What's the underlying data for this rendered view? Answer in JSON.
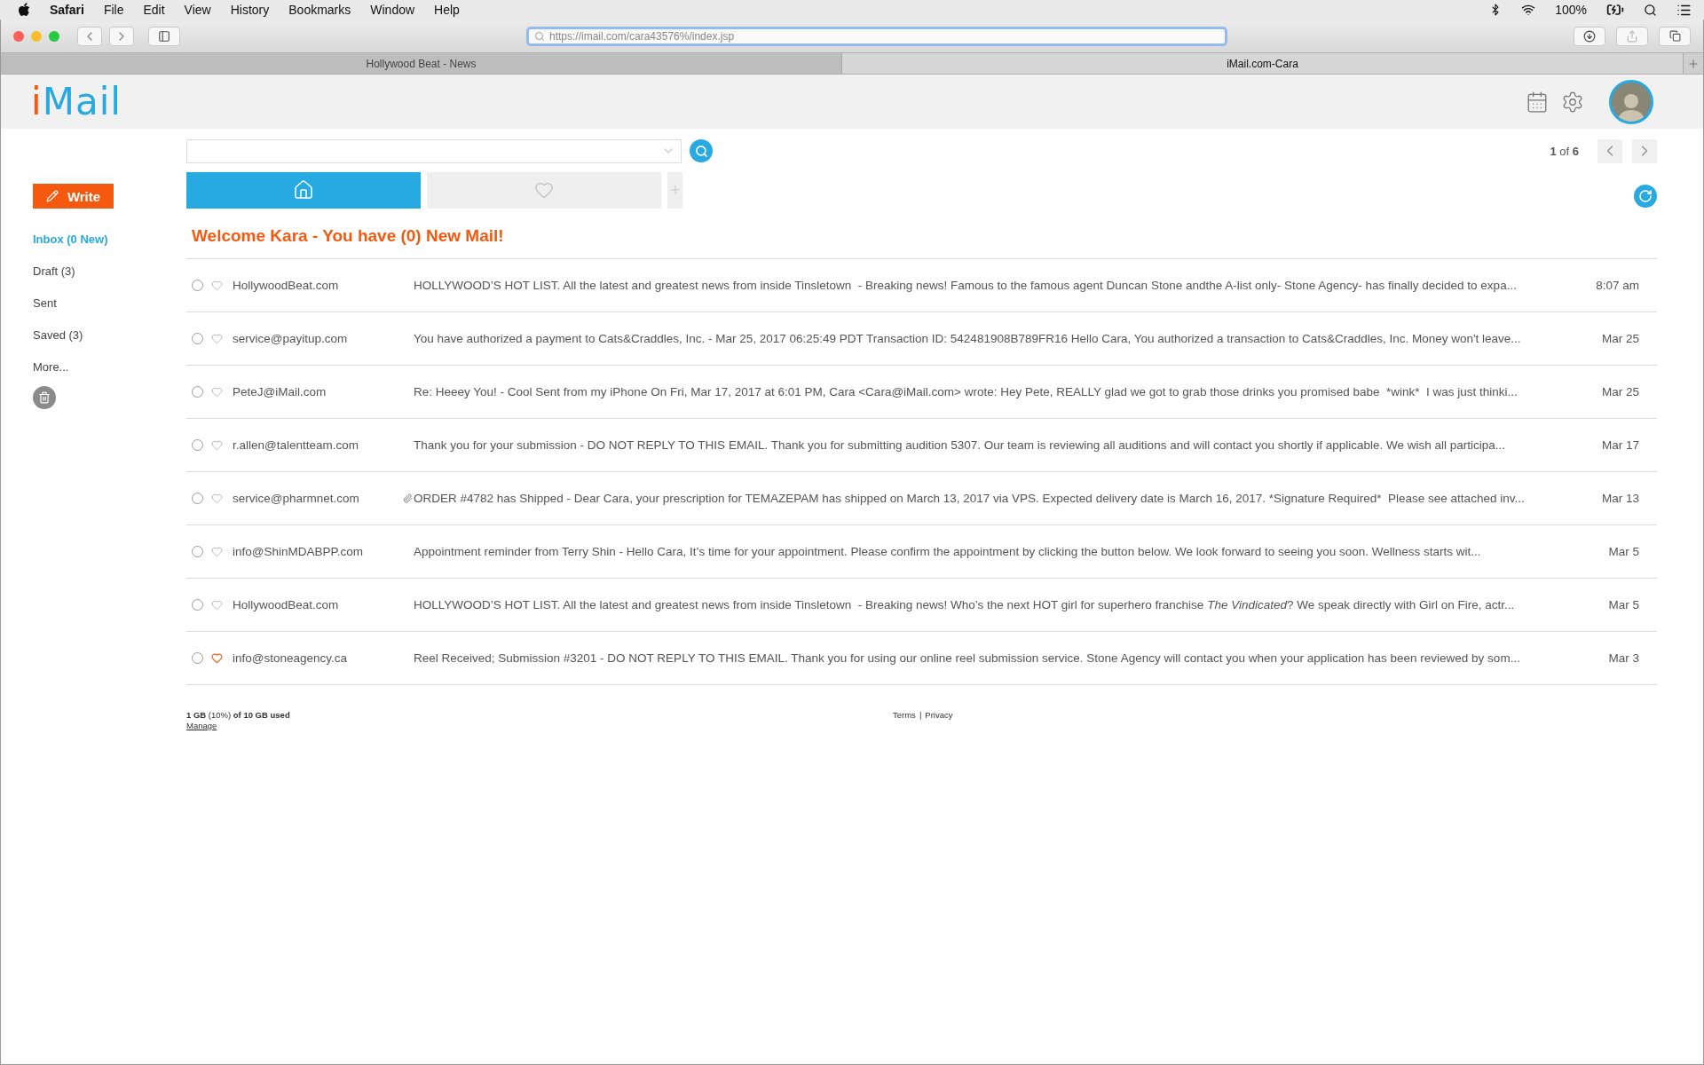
{
  "menu_bar": {
    "app": "Safari",
    "items": [
      "File",
      "Edit",
      "View",
      "History",
      "Bookmarks",
      "Window",
      "Help"
    ],
    "battery": "100%"
  },
  "browser": {
    "address": "https://imail.com/cara43576%/index.jsp",
    "tabs": [
      {
        "title": "Hollywood Beat - News",
        "selected": false
      },
      {
        "title": "iMail.com-Cara",
        "selected": true
      }
    ]
  },
  "header": {
    "logo_first": "i",
    "logo_rest": "Mail"
  },
  "sidebar": {
    "write_button": "Write",
    "items": [
      {
        "label": "Inbox (0 New)",
        "selected": true
      },
      {
        "label": "Draft (3)",
        "selected": false
      },
      {
        "label": "Sent",
        "selected": false
      },
      {
        "label": "Saved (3)",
        "selected": false
      },
      {
        "label": "More...",
        "selected": false
      }
    ]
  },
  "pager": {
    "current": "1",
    "separator": "of",
    "total": "6"
  },
  "mail_tabs": [
    {
      "kind": "home",
      "selected": true
    },
    {
      "kind": "favorites",
      "selected": false
    }
  ],
  "welcome": "Welcome Kara - You have (0) New Mail!",
  "messages": [
    {
      "checked": false,
      "favorite": false,
      "attachment": false,
      "sender": "HollywoodBeat.com",
      "snippet": [
        {
          "text": "HOLLYWOOD’S HOT LIST. All the latest and greatest news from inside Tinsletown  - Breaking news! Famous to the famous agent Duncan Stone andthe A-list only- Stone Agency- has finally decided to expa...",
          "italic": false
        }
      ],
      "date": "8:07 am"
    },
    {
      "checked": false,
      "favorite": false,
      "attachment": false,
      "sender": "service@payitup.com",
      "snippet": [
        {
          "text": "You have authorized a payment to Cats&Craddles, Inc. - Mar 25, 2017 06:25:49 PDT Transaction ID: 542481908B789FR16 Hello Cara, You authorized a transaction to Cats&Craddles, Inc. Money won't leave...",
          "italic": false
        }
      ],
      "date": "Mar 25"
    },
    {
      "checked": false,
      "favorite": false,
      "attachment": false,
      "sender": "PeteJ@iMail.com",
      "snippet": [
        {
          "text": "Re: Heeey You! - Cool Sent from my iPhone On Fri, Mar 17, 2017 at 6:01 PM, Cara <Cara@iMail.com> wrote: Hey Pete, REALLY glad we got to grab those drinks you promised babe  *wink*  I was just thinki...",
          "italic": false
        }
      ],
      "date": "Mar 25"
    },
    {
      "checked": false,
      "favorite": false,
      "attachment": false,
      "sender": "r.allen@talentteam.com",
      "snippet": [
        {
          "text": "Thank you for your submission - DO NOT REPLY TO THIS EMAIL. Thank you for submitting audition 5307. Our team is reviewing all auditions and will contact you shortly if applicable. We wish all participa...",
          "italic": false
        }
      ],
      "date": "Mar 17"
    },
    {
      "checked": false,
      "favorite": false,
      "attachment": true,
      "sender": "service@pharmnet.com",
      "snippet": [
        {
          "text": "ORDER #4782 has Shipped - Dear Cara, your prescription for TEMAZEPAM has shipped on March 13, 2017 via VPS. Expected delivery date is March 16, 2017. *Signature Required*  Please see attached inv...",
          "italic": false
        }
      ],
      "date": "Mar 13"
    },
    {
      "checked": false,
      "favorite": false,
      "attachment": false,
      "sender": "info@ShinMDABPP.com",
      "snippet": [
        {
          "text": "Appointment reminder from Terry Shin - Hello Cara, It’s time for your appointment. Please confirm the appointment by clicking the button below. We look forward to seeing you soon. Wellness starts wit...",
          "italic": false
        }
      ],
      "date": "Mar 5"
    },
    {
      "checked": false,
      "favorite": false,
      "attachment": false,
      "sender": "HollywoodBeat.com",
      "snippet": [
        {
          "text": "HOLLYWOOD’S HOT LIST. All the latest and greatest news from inside Tinsletown  - Breaking news! Who’s the next HOT girl for superhero franchise ",
          "italic": false
        },
        {
          "text": "The Vindicated",
          "italic": true
        },
        {
          "text": "? We speak directly with Girl on Fire, actr...",
          "italic": false
        }
      ],
      "date": "Mar 5"
    },
    {
      "checked": false,
      "favorite": true,
      "attachment": false,
      "sender": "info@stoneagency.ca",
      "snippet": [
        {
          "text": "Reel Received; Submission #3201 - DO NOT REPLY TO THIS EMAIL. Thank you for using our online reel submission service. Stone Agency will contact you when your application has been reviewed by som...",
          "italic": false
        }
      ],
      "date": "Mar 3"
    }
  ],
  "footer": {
    "usage": "**1 GB** (10%) **of 10 GB used**",
    "manage": "Manage",
    "terms": "Terms",
    "divider": "|",
    "privacy": "Privacy"
  }
}
